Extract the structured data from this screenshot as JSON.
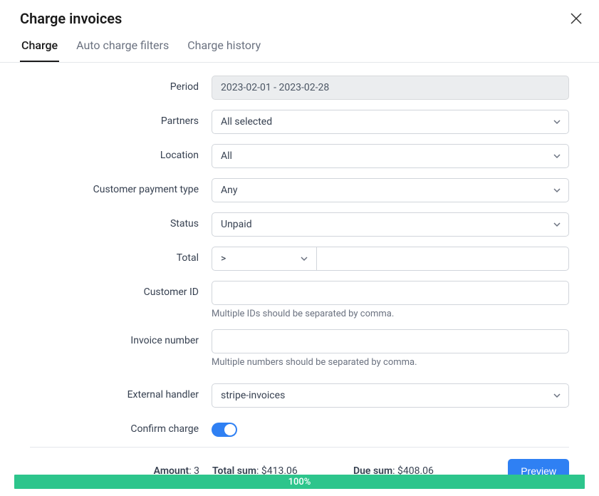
{
  "header": {
    "title": "Charge invoices"
  },
  "tabs": [
    {
      "label": "Charge",
      "active": true
    },
    {
      "label": "Auto charge filters",
      "active": false
    },
    {
      "label": "Charge history",
      "active": false
    }
  ],
  "form": {
    "period": {
      "label": "Period",
      "value": "2023-02-01 - 2023-02-28"
    },
    "partners": {
      "label": "Partners",
      "value": "All selected"
    },
    "location": {
      "label": "Location",
      "value": "All"
    },
    "payment_type": {
      "label": "Customer payment type",
      "value": "Any"
    },
    "status": {
      "label": "Status",
      "value": "Unpaid"
    },
    "total": {
      "label": "Total",
      "operator": ">",
      "value": ""
    },
    "customer_id": {
      "label": "Customer ID",
      "value": "",
      "help": "Multiple IDs should be separated by comma."
    },
    "invoice_number": {
      "label": "Invoice number",
      "value": "",
      "help": "Multiple numbers should be separated by comma."
    },
    "external_handler": {
      "label": "External handler",
      "value": "stripe-invoices"
    },
    "confirm_charge": {
      "label": "Confirm charge",
      "enabled": true
    }
  },
  "summary": {
    "amount": {
      "label": "Amount",
      "value": "3"
    },
    "total_sum": {
      "label": "Total sum",
      "value": "$413.06"
    },
    "due_sum": {
      "label": "Due sum",
      "value": "$408.06"
    },
    "preview_button": "Preview"
  },
  "progress": {
    "percent": "100%"
  }
}
